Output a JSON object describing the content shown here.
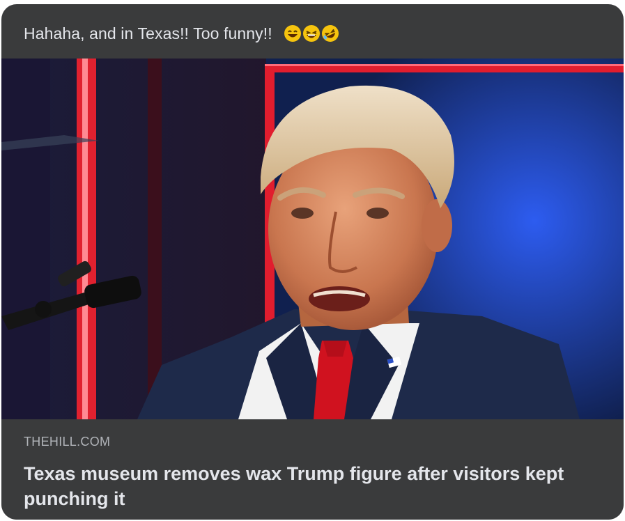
{
  "post": {
    "text": "Hahaha, and in Texas!!  Too funny!!",
    "emojis": [
      "grinning-emoji",
      "laughing-emoji",
      "rofl-emoji"
    ]
  },
  "photo": {
    "subject": "photo-of-speaker-at-podium"
  },
  "link": {
    "domain": "THEHILL.COM",
    "headline": "Texas museum removes wax Trump figure after visitors kept punching it"
  },
  "colors": {
    "card_bg": "#3a3b3c",
    "text_primary": "#e4e6eb",
    "text_secondary": "#b0b3b8",
    "stage_blue": "#1d4ed8",
    "stage_red": "#e11d2e",
    "suit_navy": "#1e2a4a",
    "tie_red": "#d0121f"
  }
}
